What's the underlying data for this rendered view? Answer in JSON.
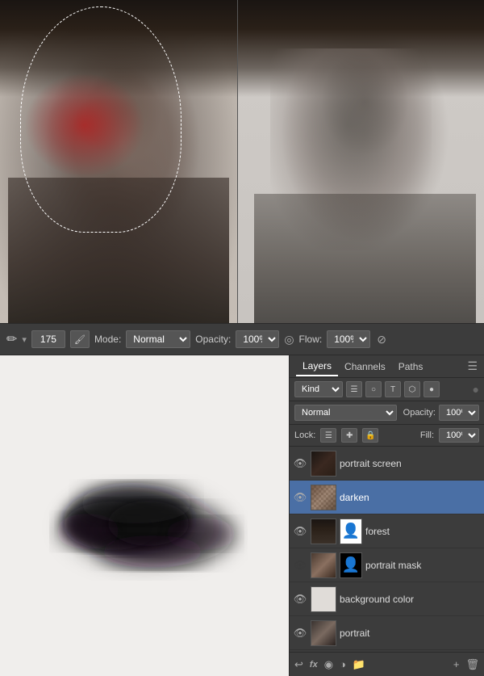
{
  "toolbar": {
    "brush_size": "175",
    "mode_label": "Mode:",
    "mode_value": "Normal",
    "opacity_label": "Opacity:",
    "opacity_value": "100%",
    "flow_label": "Flow:",
    "flow_value": "100%"
  },
  "layers_panel": {
    "tabs": [
      "Layers",
      "Channels",
      "Paths"
    ],
    "active_tab": "Layers",
    "kind_label": "Kind",
    "filter_icons": [
      "☰",
      "○",
      "T",
      "⬡",
      "●"
    ],
    "blend_mode": "Normal",
    "opacity_label": "Opacity:",
    "opacity_value": "100%",
    "lock_label": "Lock:",
    "lock_icons": [
      "☰",
      "⊕",
      "🔒"
    ],
    "fill_label": "Fill:",
    "fill_value": "100%",
    "layers": [
      {
        "name": "portrait screen",
        "visible": true,
        "thumb": "portrait-screen",
        "has_mask": false,
        "selected": false
      },
      {
        "name": "darken",
        "visible": true,
        "thumb": "darken",
        "has_mask": false,
        "selected": true
      },
      {
        "name": "forest",
        "visible": true,
        "thumb": "forest",
        "has_mask": true,
        "mask_type": "silhouette",
        "selected": false
      },
      {
        "name": "portrait mask",
        "visible": false,
        "thumb": "portrait-mask",
        "has_mask": true,
        "mask_type": "black",
        "selected": false
      },
      {
        "name": "background color",
        "visible": true,
        "thumb": "bg-color",
        "has_mask": false,
        "selected": false
      },
      {
        "name": "portrait",
        "visible": true,
        "thumb": "portrait",
        "has_mask": false,
        "selected": false
      }
    ],
    "bottom_icons": [
      "↩",
      "fx",
      "●",
      "☰",
      "📁",
      "🗑"
    ]
  }
}
